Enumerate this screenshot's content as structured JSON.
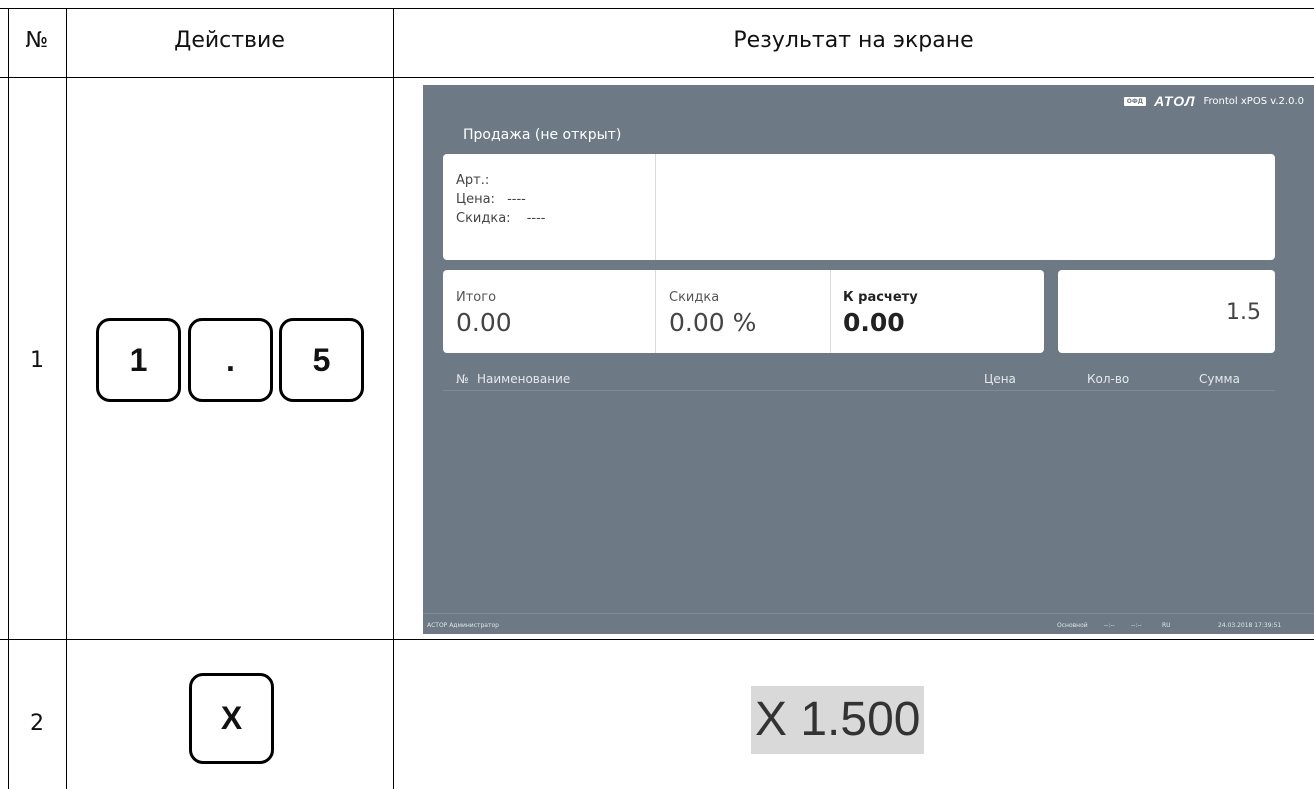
{
  "table": {
    "headers": {
      "no": "№",
      "action": "Действие",
      "result": "Результат на экране"
    },
    "rows": [
      {
        "no": "1",
        "keys": [
          "1",
          ".",
          "5"
        ]
      },
      {
        "no": "2",
        "keys": [
          "X"
        ],
        "result_text": "X 1.500"
      }
    ]
  },
  "pos": {
    "brand": {
      "ofd": "ОФД",
      "logo": "АТОЛ",
      "version": "Frontol xPOS v.2.0.0"
    },
    "mode": "Продажа (не открыт)",
    "info": {
      "art_label": "Арт.:",
      "price_label": "Цена:",
      "price_value": "----",
      "discount_label": "Скидка:",
      "discount_value": "----"
    },
    "totals": {
      "total_label": "Итого",
      "total_value": "0.00",
      "discount_label": "Скидка",
      "discount_value": "0.00 %",
      "due_label": "К расчету",
      "due_value": "0.00"
    },
    "entry_value": "1.5",
    "columns": [
      "№",
      "Наименование",
      "Цена",
      "Кол-во",
      "Сумма"
    ],
    "status": {
      "user": "АСТОР  Администратор",
      "profile": "Основной",
      "time1": "--:--",
      "time2": "--:--",
      "lang": "RU",
      "datetime": "24.03.2018 17:39:51"
    }
  },
  "colors": {
    "pos_background": "#6d7a86",
    "result_highlight": "#d9d9d9"
  }
}
